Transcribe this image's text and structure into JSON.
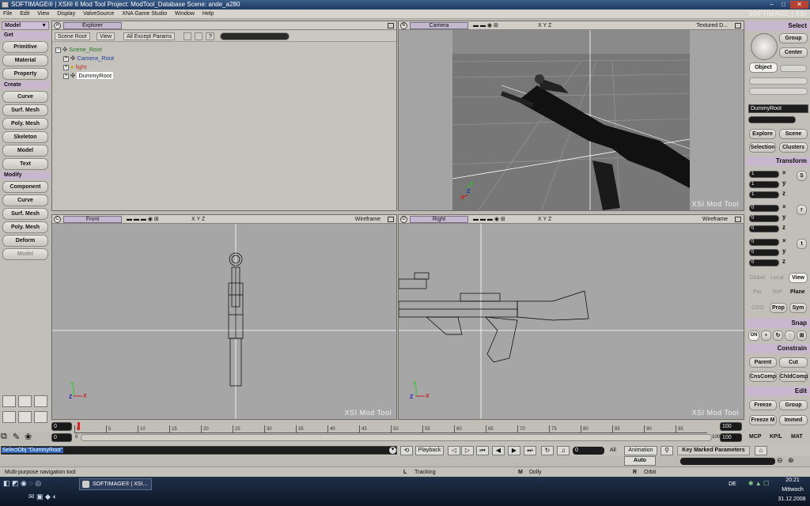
{
  "window": {
    "title": "SOFTIMAGE® | XSI® 6 Mod Tool Project: ModTool_Database   Scene: ande_a280"
  },
  "menu": {
    "items": [
      "File",
      "Edit",
      "View",
      "Display",
      "ValveSource",
      "XNA Game Studio",
      "Window",
      "Help"
    ],
    "brand": "SOFTIMAGE | XSI"
  },
  "left_panel": {
    "mode": "Model",
    "get": {
      "label": "Get",
      "buttons": [
        "Primitive",
        "Material",
        "Property"
      ]
    },
    "create": {
      "label": "Create",
      "buttons": [
        "Curve",
        "Surf. Mesh",
        "Poly. Mesh",
        "Skeleton",
        "Model",
        "Text"
      ]
    },
    "modify": {
      "label": "Modify",
      "buttons": [
        "Component",
        "Curve",
        "Surf. Mesh",
        "Poly. Mesh",
        "Deform",
        "Model"
      ]
    }
  },
  "explorer": {
    "letter": "A",
    "title": "Explorer",
    "toolbar": {
      "scope": "Scene Root",
      "view": "View",
      "filter": "All Except Params"
    },
    "tree": [
      "Scene_Root",
      "Camera_Root",
      "light",
      "DummyRoot"
    ]
  },
  "viewports": {
    "b": {
      "letter": "B",
      "camera": "Camera",
      "axes": "X Y Z",
      "mode": "Textured D...",
      "watermark": "XSI Mod Tool"
    },
    "c": {
      "letter": "C",
      "camera": "Front",
      "axes": "X Y Z",
      "mode": "Wireframe",
      "watermark": "XSI Mod Tool"
    },
    "d": {
      "letter": "D",
      "camera": "Right",
      "axes": "X Y Z",
      "mode": "Wireframe",
      "watermark": "XSI Mod Tool"
    }
  },
  "right_panel": {
    "select": "Select",
    "group_btn": "Group",
    "center_btn": "Center",
    "object_btn": "Object",
    "selection_name": "DummyRoot",
    "explore": "Explore",
    "scene": "Scene",
    "selection": "Selection",
    "clusters": "Clusters",
    "transform": "Transform",
    "sx": "1",
    "sy": "1",
    "sz": "1",
    "rx": "0",
    "ry": "0",
    "rz": "0",
    "tx": "0",
    "ty": "0",
    "tz": "0",
    "global": "Global",
    "local": "Local",
    "view": "View",
    "par": "Par",
    "ref": "Ref",
    "plane": "Plane",
    "cog": "COG",
    "prop": "Prop",
    "sym": "Sym",
    "snap": "Snap",
    "snap_on": "ON",
    "constrain": "Constrain",
    "parent": "Parent",
    "cut": "Cut",
    "cnscomp": "CnsComp",
    "chldcomp": "ChldComp",
    "edit": "Edit",
    "freeze": "Freeze",
    "group": "Group",
    "freeze_m": "Freeze M",
    "immed": "Immed",
    "tabs": [
      "MCP",
      "KP/L",
      "MAT"
    ]
  },
  "timeline": {
    "start": "0",
    "current": "0",
    "end": "100",
    "end2": "100",
    "range_end": "100",
    "ticks": [
      "0",
      "5",
      "10",
      "15",
      "20",
      "25",
      "30",
      "35",
      "40",
      "45",
      "50",
      "55",
      "60",
      "65",
      "70",
      "75",
      "80",
      "85",
      "90",
      "95"
    ]
  },
  "command": {
    "text": "SelectObj \"DummyRoot\"",
    "playback": "Playback",
    "frame": "0",
    "all": "All",
    "animation": "Animation",
    "auto": "Auto",
    "key_marked": "Key Marked Parameters"
  },
  "status": {
    "hint": "Multi-purpose navigation tool",
    "l": "Tracking",
    "m": "Dolly",
    "r": "Orbit"
  },
  "taskbar": {
    "task": "SOFTIMAGE® | XSI...",
    "lang": "DE",
    "time": "20:21",
    "day": "Mittwoch",
    "date": "31.12.2008"
  }
}
